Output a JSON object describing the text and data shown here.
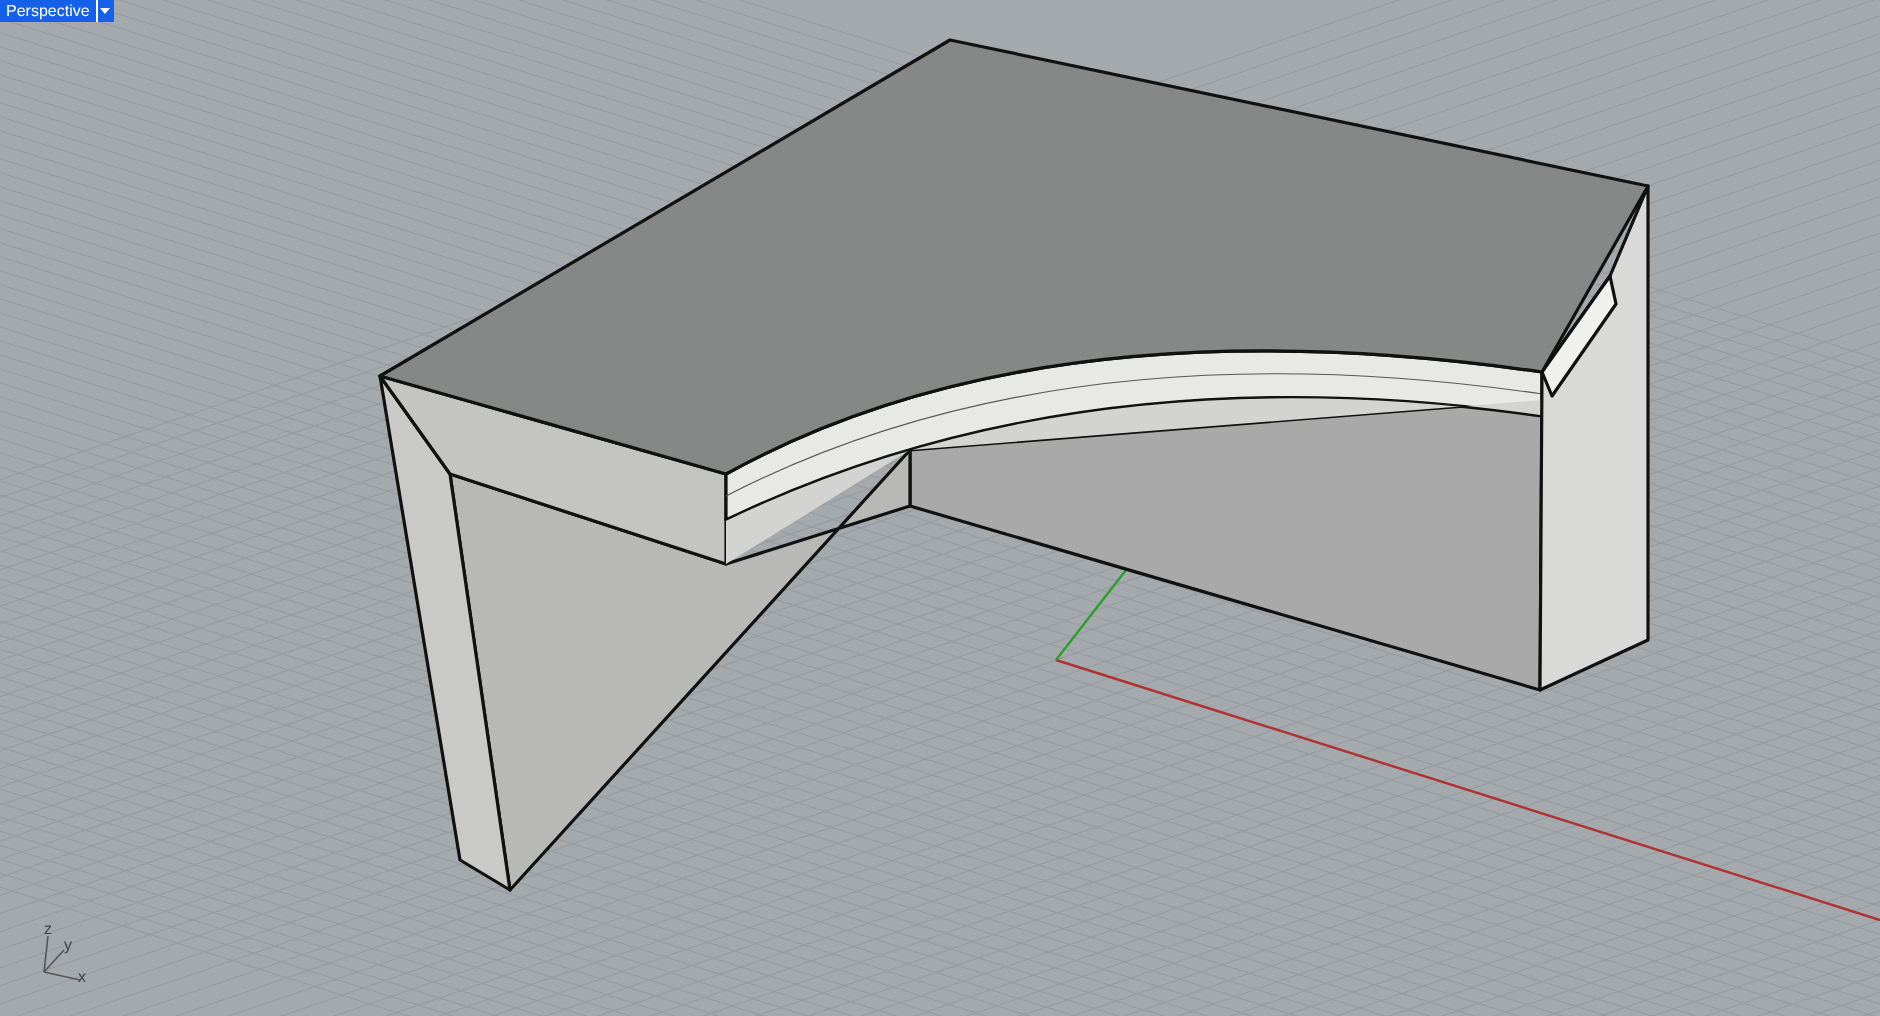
{
  "viewport": {
    "title": "Perspective"
  },
  "axis_icon": {
    "labels": [
      "z",
      "y",
      "x"
    ]
  }
}
